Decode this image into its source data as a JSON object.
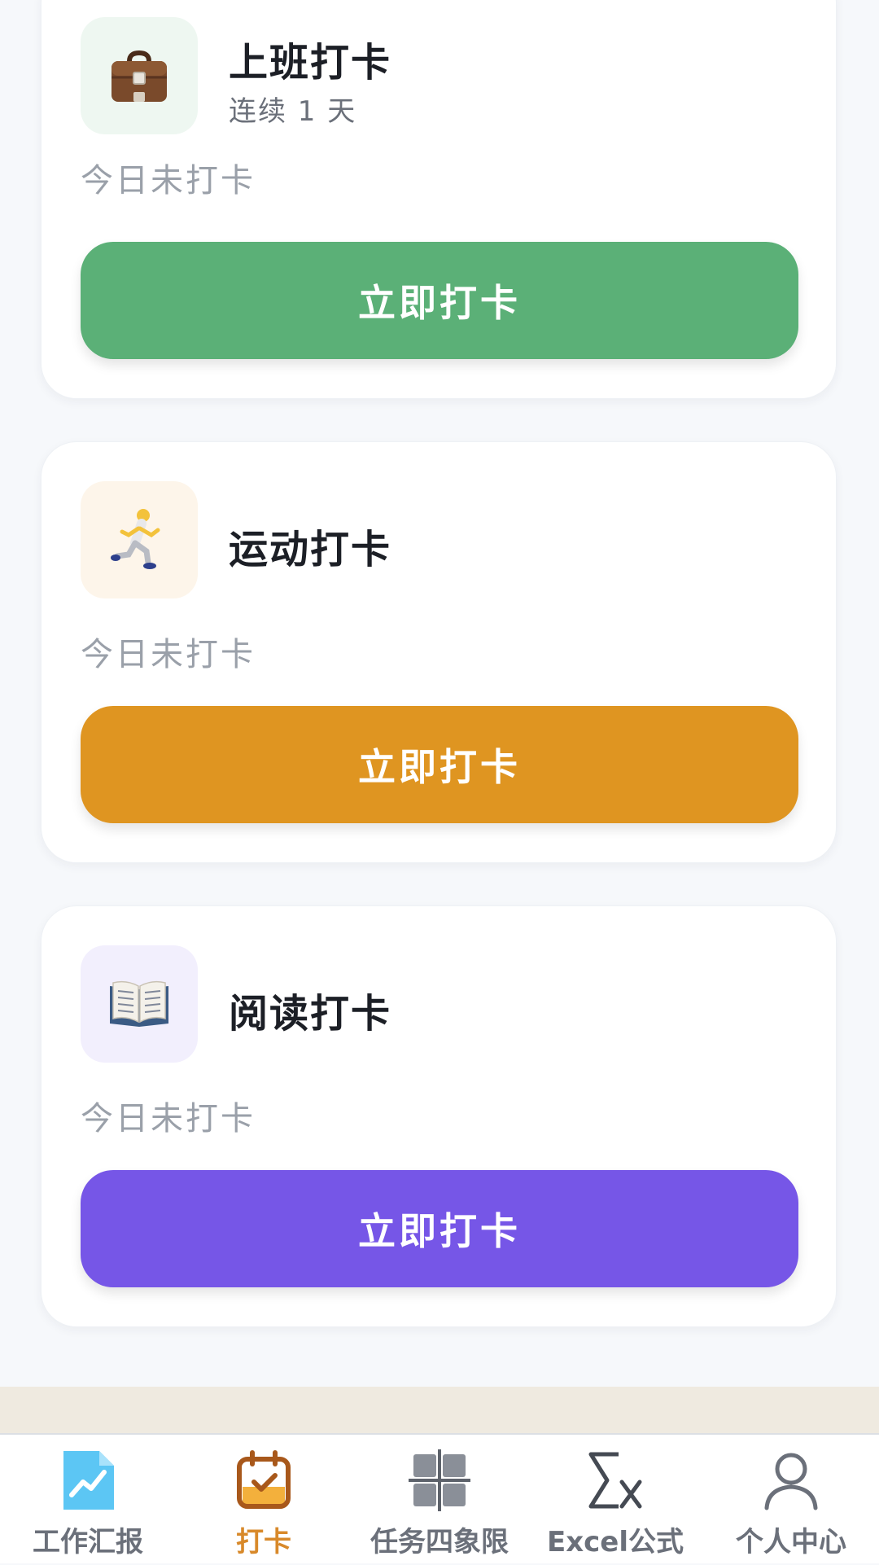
{
  "cards": [
    {
      "title": "上班打卡",
      "streak": "连续 1 天",
      "status": "今日未打卡",
      "button_label": "立即打卡",
      "icon": "briefcase-icon",
      "icon_bg": "#eef7f1",
      "button_color": "#5bb077"
    },
    {
      "title": "运动打卡",
      "status": "今日未打卡",
      "button_label": "立即打卡",
      "icon": "runner-icon",
      "icon_bg": "#fdf5ea",
      "button_color": "#df9521"
    },
    {
      "title": "阅读打卡",
      "status": "今日未打卡",
      "button_label": "立即打卡",
      "icon": "open-book-icon",
      "icon_bg": "#f2effd",
      "button_color": "#7656e7"
    }
  ],
  "tabbar": {
    "active_color": "#d8892a",
    "inactive_color": "#6b707a",
    "items": [
      {
        "label": "工作汇报",
        "icon": "work-report-icon",
        "active": false
      },
      {
        "label": "打卡",
        "icon": "calendar-check-icon",
        "active": true
      },
      {
        "label": "任务四象限",
        "icon": "quadrant-grid-icon",
        "active": false
      },
      {
        "label": "Excel公式",
        "icon": "sigma-x-icon",
        "active": false
      },
      {
        "label": "个人中心",
        "icon": "user-icon",
        "active": false
      }
    ]
  }
}
